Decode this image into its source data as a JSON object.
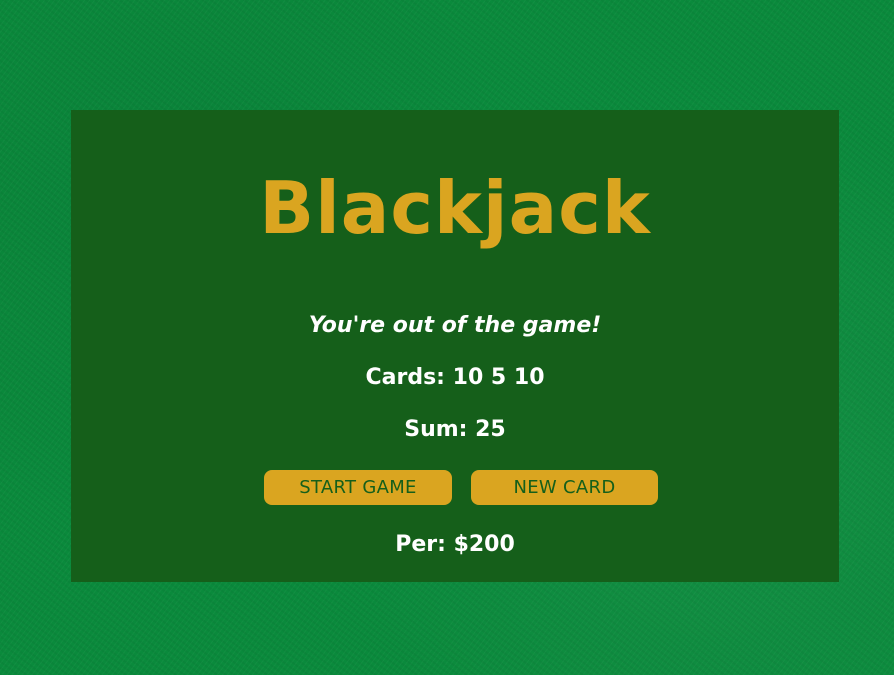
{
  "game": {
    "title": "Blackjack",
    "message": "You're out of the game!",
    "cards_label": "Cards: ",
    "cards_value": "10 5 10",
    "sum_label": "Sum: ",
    "sum_value": "25",
    "player_label": "Per: ",
    "player_chips": "$200"
  },
  "buttons": {
    "start_label": "START GAME",
    "new_card_label": "NEW CARD"
  },
  "colors": {
    "felt": "#0a8a3c",
    "panel": "#155f1a",
    "accent": "#daa520",
    "text": "#ffffff"
  }
}
